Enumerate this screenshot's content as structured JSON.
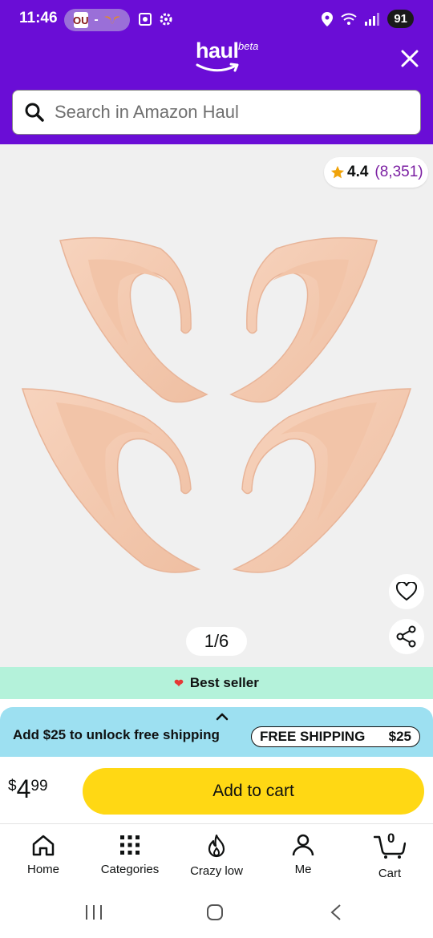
{
  "status_bar": {
    "time": "11:46",
    "battery": "91",
    "pill_logo": "OU",
    "pill_separator": "-"
  },
  "header": {
    "logo_text": "haul",
    "logo_badge": "beta",
    "close_icon": "close-icon"
  },
  "search": {
    "placeholder": "Search in Amazon Haul",
    "icon": "search-icon"
  },
  "product": {
    "rating_value": "4.4",
    "rating_count": "(8,351)",
    "image_counter": "1/6",
    "best_seller_label": "Best seller"
  },
  "shipping": {
    "message": "Add $25 to unlock free shipping",
    "badge_label": "FREE SHIPPING",
    "badge_amount": "$25"
  },
  "purchase": {
    "currency": "$",
    "price_whole": "4",
    "price_cents": "99",
    "add_to_cart_label": "Add to cart"
  },
  "bottom_nav": {
    "items": [
      {
        "label": "Home",
        "icon": "home-icon"
      },
      {
        "label": "Categories",
        "icon": "grid-icon"
      },
      {
        "label": "Crazy low",
        "icon": "flame-icon"
      },
      {
        "label": "Me",
        "icon": "person-icon"
      },
      {
        "label": "Cart",
        "icon": "cart-icon"
      }
    ],
    "cart_count": "0"
  },
  "colors": {
    "header_purple": "#6a0dd6",
    "best_seller_bg": "#b4f2da",
    "shipping_bg": "#9de0f1",
    "add_to_cart_yellow": "#ffd814",
    "rating_count_purple": "#7b1fa2",
    "star_gold": "#f0a30a"
  }
}
